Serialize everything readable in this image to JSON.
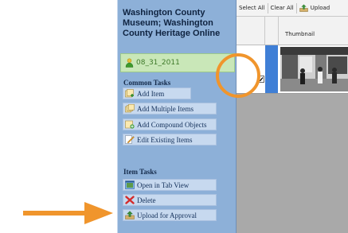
{
  "sidebar": {
    "collection_name": "Washington County Museum; Washington County Heritage Online",
    "user": {
      "name": "08_31_2011",
      "icon": "user-icon"
    },
    "common_tasks": {
      "title": "Common Tasks",
      "items": [
        {
          "label": "Add Item",
          "icon": "add-item-icon"
        },
        {
          "label": "Add Multiple Items",
          "icon": "add-multiple-items-icon"
        },
        {
          "label": "Add Compound Objects",
          "icon": "add-compound-object-icon"
        },
        {
          "label": "Edit Existing Items",
          "icon": "edit-items-icon"
        }
      ]
    },
    "item_tasks": {
      "title": "Item Tasks",
      "items": [
        {
          "label": "Open in Tab View",
          "icon": "tab-view-icon"
        },
        {
          "label": "Delete",
          "icon": "delete-icon"
        },
        {
          "label": "Upload for Approval",
          "icon": "upload-icon"
        }
      ]
    }
  },
  "toolbar": {
    "select_all": "Select All",
    "clear_all": "Clear All",
    "upload": "Upload"
  },
  "grid": {
    "header": {
      "thumbnail": "Thumbnail"
    },
    "rows": [
      {
        "checked": true
      }
    ]
  },
  "annotations": {
    "circle_color": "#f0952c",
    "arrow_color": "#f0952c"
  },
  "colors": {
    "sidebar_bg": "#8db0d8",
    "user_box_bg": "#c9e7b8",
    "task_bg": "#c7d9ef",
    "selection_blue": "#3f7fd6"
  }
}
